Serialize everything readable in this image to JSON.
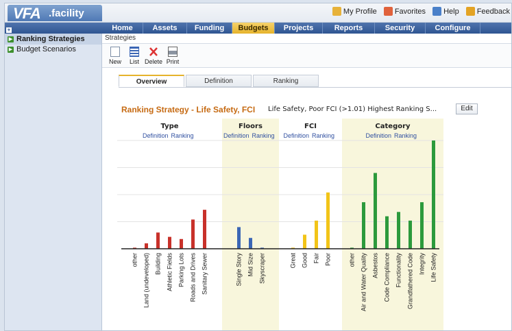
{
  "app": {
    "logo_main": "VFA",
    "logo_sub": ".facility"
  },
  "toplinks": [
    {
      "label": "My Profile",
      "icon": "profile-icon",
      "color": "#e7b23a"
    },
    {
      "label": "Favorites",
      "icon": "favorites-icon",
      "color": "#e0623c"
    },
    {
      "label": "Help",
      "icon": "help-icon",
      "color": "#4a80c9"
    },
    {
      "label": "Feedback",
      "icon": "feedback-icon",
      "color": "#e3a324"
    }
  ],
  "nav": [
    {
      "label": "Home",
      "width": 60
    },
    {
      "label": "Assets",
      "width": 64
    },
    {
      "label": "Funding",
      "width": 66
    },
    {
      "label": "Budgets",
      "width": 62,
      "active": true
    },
    {
      "label": "Projects",
      "width": 70
    },
    {
      "label": "Reports",
      "width": 76
    },
    {
      "label": "Security",
      "width": 74
    },
    {
      "label": "Configure",
      "width": 80
    }
  ],
  "sidebar": {
    "items": [
      {
        "label": "Ranking Strategies",
        "active": true
      },
      {
        "label": "Budget Scenarios",
        "active": false
      }
    ]
  },
  "breadcrumb": "Strategies",
  "toolbar": [
    {
      "label": "New",
      "icon": "new-document-icon"
    },
    {
      "label": "List",
      "icon": "list-icon"
    },
    {
      "label": "Delete",
      "icon": "delete-icon"
    },
    {
      "label": "Print",
      "icon": "print-icon"
    }
  ],
  "tabs": [
    {
      "label": "Overview",
      "active": true
    },
    {
      "label": "Definition",
      "active": false
    },
    {
      "label": "Ranking",
      "active": false
    }
  ],
  "strategy": {
    "title": "Ranking Strategy - Life Safety, FCI",
    "description": "Life Safety, Poor FCI (>1.01) Highest Ranking S...",
    "edit_label": "Edit"
  },
  "chart_data": {
    "type": "bar",
    "groups": [
      {
        "name": "Type",
        "color": "#c8312a",
        "shaded": false,
        "links": [
          "Definition",
          "Ranking"
        ],
        "categories": [
          "other",
          "Land (undeveloped)",
          "Building",
          "Athletic Fields",
          "Parking Lots",
          "Roads and Drives",
          "Sanitary Sewer"
        ],
        "values": [
          1,
          5,
          15,
          11,
          9,
          27,
          36
        ]
      },
      {
        "name": "Floors",
        "color": "#3b66b5",
        "shaded": true,
        "links": [
          "Definition",
          "Ranking"
        ],
        "categories": [
          "Single Story",
          "Mid Size",
          "Skyscraper"
        ],
        "values": [
          20,
          10,
          1
        ]
      },
      {
        "name": "FCI",
        "color": "#f2c418",
        "shaded": false,
        "links": [
          "Definition",
          "Ranking"
        ],
        "categories": [
          "Great",
          "Good",
          "Fair",
          "Poor"
        ],
        "values": [
          1,
          13,
          26,
          52
        ]
      },
      {
        "name": "Category",
        "color": "#2c9a3c",
        "shaded": true,
        "links": [
          "Definition",
          "Ranking"
        ],
        "categories": [
          "other",
          "Air and Water Quality",
          "Asbestos",
          "Code Compliance",
          "Functionality",
          "Grandfathered Code",
          "Integrity",
          "Life Safety"
        ],
        "values": [
          1,
          43,
          70,
          30,
          34,
          26,
          43,
          100
        ]
      }
    ],
    "ylim": [
      0,
      100
    ],
    "grid": true
  }
}
